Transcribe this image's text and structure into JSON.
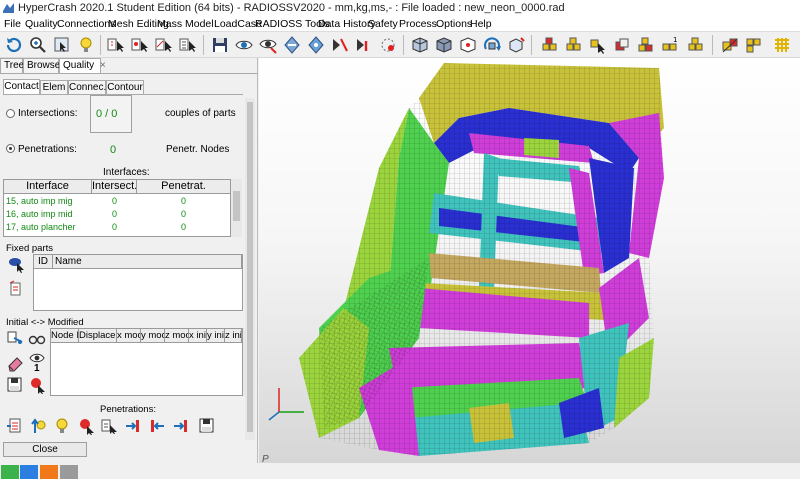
{
  "window": {
    "title": "HyperCrash 2020.1 Student Edition (64 bits) - RADIOSSV2020 - mm,kg,ms,- : File loaded : new_neon_0000.rad"
  },
  "menu": [
    "File",
    "Quality",
    "Connections",
    "Mesh Editing",
    "Mass",
    "Model",
    "LoadCase",
    "RADIOSS Tools",
    "Data History",
    "Safety",
    "Process",
    "Options",
    "Help"
  ],
  "panel_tabs": {
    "tree": "Tree",
    "browser": "Browser",
    "quality": "Quality",
    "close": "×"
  },
  "sub_tabs": [
    "Contact",
    "Elem",
    "Connec.",
    "Contour"
  ],
  "contact": {
    "intersections_label": "Intersections:",
    "intersections_value": "0   /   0",
    "couples_label": "couples of parts",
    "penetrations_label": "Penetrations:",
    "penetrations_value": "0",
    "penetr_nodes_label": "Penetr. Nodes",
    "interfaces_title": "Interfaces:",
    "interfaces_columns": [
      "Interface",
      "Intersect.",
      "Penetrat."
    ],
    "interfaces_rows": [
      [
        "15, auto imp mig",
        "0",
        "0"
      ],
      [
        "16, auto imp mid",
        "0",
        "0"
      ],
      [
        "17, auto plancher",
        "0",
        "0"
      ]
    ],
    "fixed_parts_title": "Fixed parts",
    "fixed_columns": [
      "ID",
      "Name"
    ],
    "modified_title": "Initial <-> Modified",
    "modified_columns": [
      "Node ID",
      "Displacem",
      "x mod",
      "y mod",
      "z mod",
      "x ini",
      "y ini",
      "z ini"
    ],
    "penetrations_section_title": "Penetrations:",
    "eye_count": "1",
    "close_label": "Close"
  },
  "viewport": {
    "corner_label": "P"
  },
  "colors": {
    "accent_green": "#138a13",
    "mesh_yellow": "#c8c23a",
    "mesh_blue": "#2a2fd1",
    "mesh_cyan": "#40c2bd",
    "mesh_green": "#4fd04f",
    "mesh_magenta": "#cf3ed8",
    "mesh_tan": "#c4a85f",
    "mesh_lime": "#9bd43c"
  },
  "status_swatches": [
    "#3bb34a",
    "#2b7fe0",
    "#f07a1a",
    "#9a9a9a"
  ]
}
